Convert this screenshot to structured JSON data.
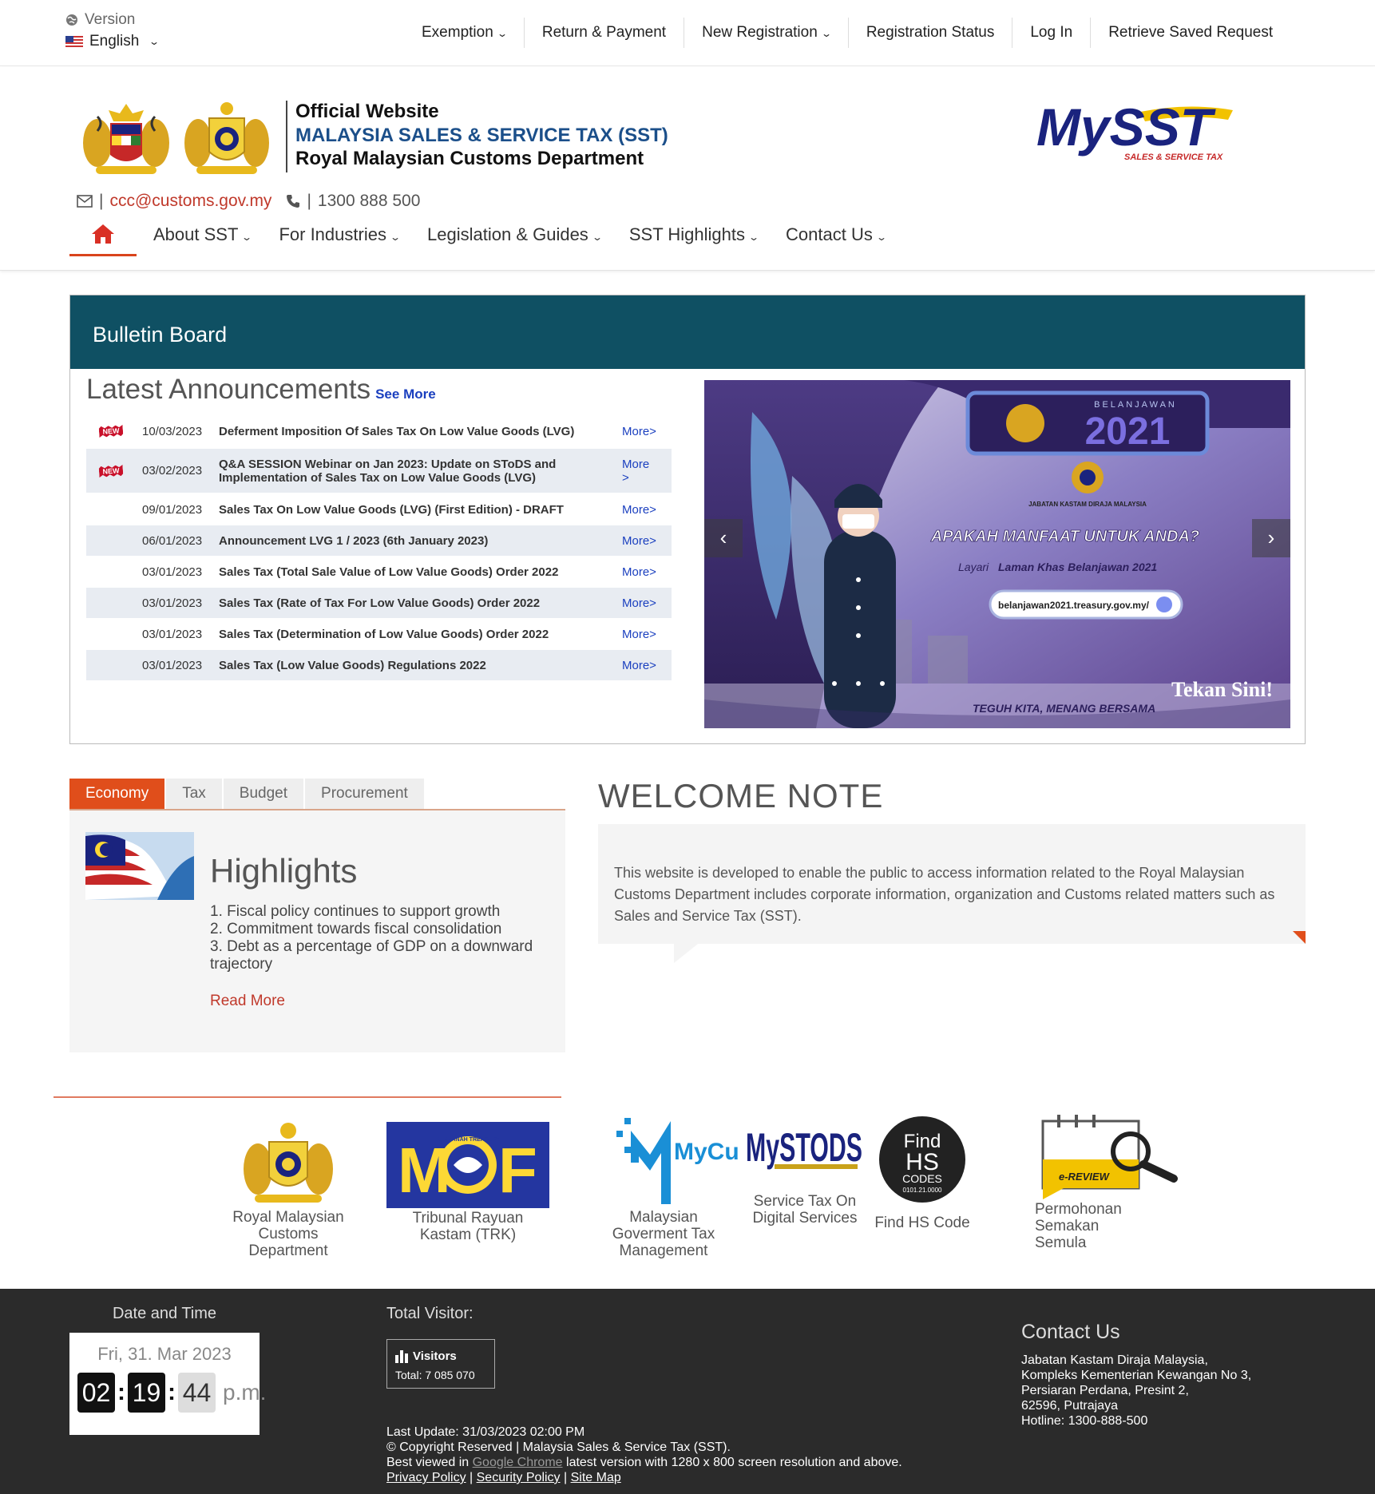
{
  "topbar": {
    "version_label": "Version",
    "language": "English",
    "nav": [
      "Exemption",
      "Return & Payment",
      "New Registration",
      "Registration Status",
      "Log In",
      "Retrieve Saved Request"
    ]
  },
  "header": {
    "line1": "Official Website",
    "line2": "MALAYSIA SALES & SERVICE TAX (SST)",
    "line3": "Royal Malaysian Customs Department",
    "logo_text": "MySST",
    "logo_tagline": "SALES & SERVICE TAX",
    "email": "ccc@customs.gov.my",
    "phone": "1300 888 500"
  },
  "mainnav": {
    "items": [
      "About SST",
      "For Industries",
      "Legislation & Guides",
      "SST Highlights",
      "Contact Us"
    ]
  },
  "bulletin": {
    "title": "Bulletin Board",
    "latest_title": "Latest Announcements",
    "see_more": "See More",
    "badge_text": "NEW",
    "announcements": [
      {
        "date": "10/03/2023",
        "title": "Deferment Imposition Of Sales Tax On Low Value Goods (LVG)",
        "more": "More>",
        "new": true
      },
      {
        "date": "03/02/2023",
        "title": "Q&A SESSION Webinar on Jan 2023: Update on SToDS and Implementation of Sales Tax on Low Value Goods (LVG)",
        "more": "More >",
        "new": true
      },
      {
        "date": "09/01/2023",
        "title": "Sales Tax On Low Value Goods (LVG) (First Edition) - DRAFT",
        "more": "More>",
        "new": false
      },
      {
        "date": "06/01/2023",
        "title": "Announcement LVG 1 / 2023 (6th January 2023)",
        "more": "More>",
        "new": false
      },
      {
        "date": "03/01/2023",
        "title": "Sales Tax (Total Sale Value of Low Value Goods) Order 2022",
        "more": "More>",
        "new": false
      },
      {
        "date": "03/01/2023",
        "title": "Sales Tax (Rate of Tax For Low Value Goods) Order 2022",
        "more": "More>",
        "new": false
      },
      {
        "date": "03/01/2023",
        "title": "Sales Tax (Determination of Low Value Goods) Order 2022",
        "more": "More>",
        "new": false
      },
      {
        "date": "03/01/2023",
        "title": "Sales Tax (Low Value Goods) Regulations 2022",
        "more": "More>",
        "new": false
      }
    ],
    "banner": {
      "kicker": "BELANJAWAN",
      "year": "2021",
      "agency": "JABATAN KASTAM DIRAJA MALAYSIA",
      "headline": "APAKAH MANFAAT UNTUK ANDA?",
      "sub_prefix": "Layari ",
      "sub_bold": "Laman Khas Belanjawan 2021",
      "url": "belanjawan2021.treasury.gov.my/",
      "cta": "Tekan Sini!",
      "slogan": "TEGUH KITA, MENANG BERSAMA"
    }
  },
  "tabs": {
    "items": [
      "Economy",
      "Tax",
      "Budget",
      "Procurement"
    ],
    "active": "Economy",
    "highlights_title": "Highlights",
    "highlights": [
      "1. Fiscal policy continues to support growth",
      "2. Commitment towards fiscal consolidation",
      "3. Debt as a percentage of GDP on a downward trajectory"
    ],
    "read_more": "Read More"
  },
  "welcome": {
    "title": "WELCOME NOTE",
    "text": "This website is developed to enable the public to access information related to the Royal Malaysian Customs Department includes corporate information, organization and Customs related matters such as Sales and Service Tax (SST)."
  },
  "links": [
    {
      "label": "Royal Malaysian Customs Department",
      "icon": "jkdm-crest-icon"
    },
    {
      "label": "Tribunal Rayuan Kastam (TRK)",
      "icon": "mof-logo-icon",
      "logo_text_left": "M",
      "logo_text_right": "F",
      "logo_ring": "KHAZANAH TREASURY"
    },
    {
      "label": "Malaysian Goverment Tax Management",
      "icon": "mycukai-logo-icon",
      "logo_text": "MyCukai"
    },
    {
      "label": "Service Tax On Digital Services",
      "icon": "mystods-logo-icon",
      "logo_text": "MySTODS"
    },
    {
      "label": "Find HS Code",
      "icon": "find-hs-code-icon",
      "logo_text_1": "Find",
      "logo_text_2": "HS",
      "logo_text_3": "CODES",
      "logo_text_4": "0101.21.0000"
    },
    {
      "label": "Permohonan Semakan Semula",
      "icon": "e-review-icon",
      "logo_text": "e-REVIEW"
    }
  ],
  "footer": {
    "dt_title": "Date and Time",
    "date": "Fri, 31. Mar 2023",
    "hour": "02",
    "minute": "19",
    "second": "44",
    "ampm": "p.m.",
    "visitor_title": "Total Visitor:",
    "visitors_label": "Visitors",
    "visitors_total": "Total: 7 085 070",
    "last_update": "Last Update: 31/03/2023 02:00 PM",
    "copyright": "© Copyright Reserved | Malaysia Sales & Service Tax (SST).",
    "best_viewed_prefix": "Best viewed in ",
    "best_viewed_link": "Google Chrome",
    "best_viewed_suffix": " latest version with 1280 x 800 screen resolution and above.",
    "privacy": "Privacy Policy",
    "security": "Security Policy",
    "sitemap": "Site Map",
    "sep": " | ",
    "contact_title": "Contact Us",
    "contact_lines": [
      "Jabatan Kastam Diraja Malaysia,",
      "Kompleks Kementerian Kewangan No 3,",
      "Persiaran Perdana, Presint 2,",
      "62596, Putrajaya",
      "Hotline: 1300-888-500"
    ]
  },
  "colors": {
    "teal_header": "#0f5063",
    "accent_orange": "#e04e1b",
    "link_blue": "#1a3fbf",
    "footer_bg": "#2b2b2b",
    "sst_blue": "#1b4f8a"
  }
}
